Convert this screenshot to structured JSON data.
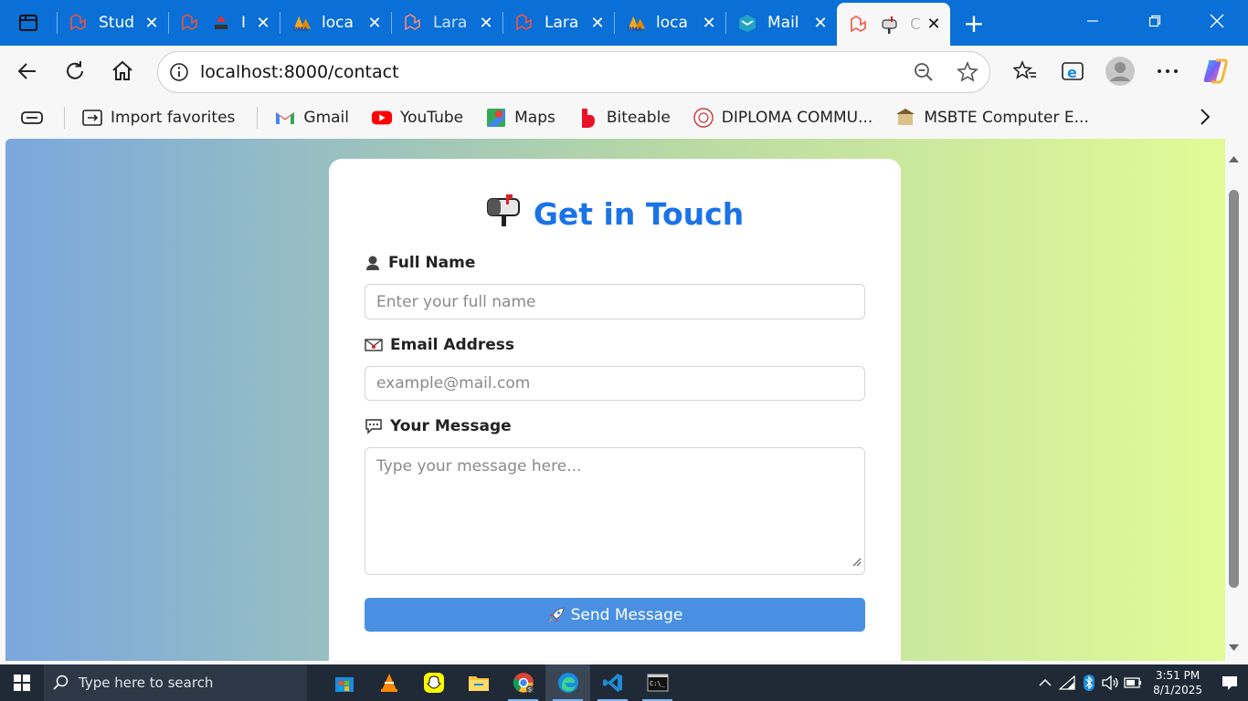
{
  "browser": {
    "tabs": [
      {
        "title": "Stud",
        "icon": "laravel-icon"
      },
      {
        "title": "I",
        "icon": "laravel-icon"
      },
      {
        "title": "loca",
        "icon": "phpmyadmin-icon"
      },
      {
        "title": "Lara",
        "icon": "laravel-icon"
      },
      {
        "title": "Lara",
        "icon": "laravel-icon"
      },
      {
        "title": "loca",
        "icon": "phpmyadmin-icon"
      },
      {
        "title": "Mail",
        "icon": "mailtrap-icon"
      },
      {
        "title": "C",
        "icon": "laravel-icon",
        "active": true
      }
    ],
    "address": "localhost:8000/contact",
    "favorites": [
      {
        "label": "Import favorites",
        "icon": "import-icon"
      },
      {
        "label": "Gmail",
        "icon": "gmail-icon"
      },
      {
        "label": "YouTube",
        "icon": "youtube-icon"
      },
      {
        "label": "Maps",
        "icon": "maps-icon"
      },
      {
        "label": "Biteable",
        "icon": "biteable-icon"
      },
      {
        "label": "DIPLOMA COMMU...",
        "icon": "college-icon"
      },
      {
        "label": "MSBTE Computer E...",
        "icon": "msbte-icon"
      }
    ]
  },
  "form": {
    "title": "Get in Touch",
    "name_label": "Full Name",
    "name_placeholder": "Enter your full name",
    "email_label": "Email Address",
    "email_placeholder": "example@mail.com",
    "message_label": "Your Message",
    "message_placeholder": "Type your message here...",
    "submit_label": "Send Message",
    "accent_color": "#1a73e8",
    "button_color": "#4a90e2"
  },
  "taskbar": {
    "search_placeholder": "Type here to search",
    "time": "3:51 PM",
    "date": "8/1/2025"
  }
}
